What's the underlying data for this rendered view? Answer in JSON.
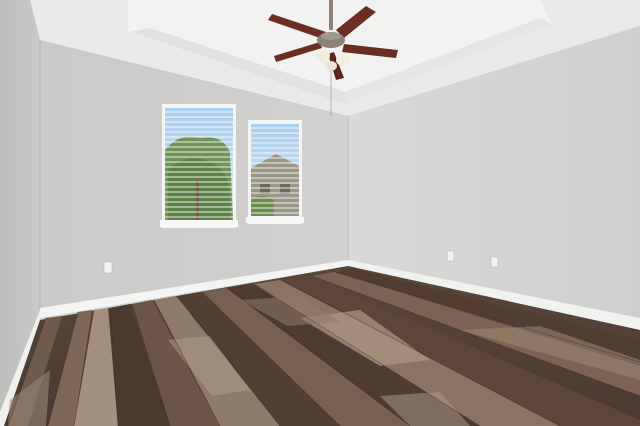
{
  "scene": {
    "colors": {
      "ceiling": "#ececea",
      "tray": "#f3f3f1",
      "left_wall": "#c4c4c2",
      "back_wall": "#cfcfcd",
      "right_wall": "#d6d6d4",
      "baseboard": "#f4f4f2",
      "floor_dark": "#3b2c22",
      "floor_mid": "#6a5444",
      "floor_light": "#a28e7c",
      "sky": "#b6d4ee",
      "tree": "#6f9456",
      "blinds": "#eef1f3",
      "fan_blade": "#6a2e22",
      "fan_metal": "#8c8276"
    },
    "icons": [
      "ceiling-fan-icon",
      "window-blinds-icon",
      "power-outlet-icon"
    ]
  }
}
